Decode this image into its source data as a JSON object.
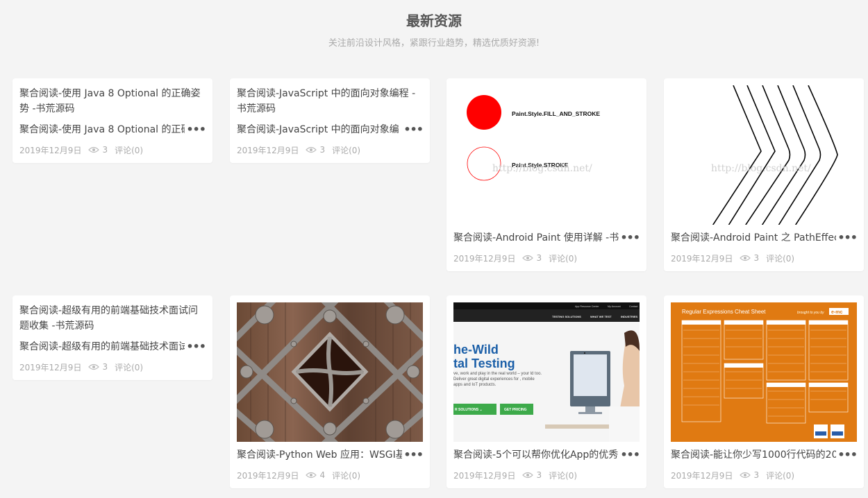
{
  "section": {
    "title": "最新资源",
    "subtitle": "关注前沿设计风格，紧跟行业趋势，精选优质好资源!"
  },
  "cards": [
    {
      "title": "聚合阅读-使用 Java 8 Optional 的正确姿势 -书荒源码",
      "desc": "聚合阅读-使用 Java 8 Optional 的正确",
      "date": "2019年12月9日",
      "views": "3",
      "comments": "评论(0)"
    },
    {
      "title": "聚合阅读-JavaScript 中的面向对象编程 -书荒源码",
      "desc": "聚合阅读-JavaScript 中的面向对象编",
      "date": "2019年12月9日",
      "views": "3",
      "comments": "评论(0)"
    },
    {
      "title": "聚合阅读-Android Paint 使用详解 -书",
      "date": "2019年12月9日",
      "views": "3",
      "comments": "评论(0)",
      "img_label_1": "Paint.Style.FILL_AND_STROKE",
      "img_label_2": "Paint.Style.STROKE",
      "watermark": "http://blog.csdn.net/"
    },
    {
      "title": "聚合阅读-Android Paint 之 PathEffec",
      "date": "2019年12月9日",
      "views": "3",
      "comments": "评论(0)",
      "watermark": "http://blog.csdn.net/"
    },
    {
      "title": "聚合阅读-超级有用的前端基础技术面试问题收集 -书荒源码",
      "desc": "聚合阅读-超级有用的前端基础技术面试",
      "date": "2019年12月9日",
      "views": "3",
      "comments": "评论(0)"
    },
    {
      "title": "聚合阅读-Python Web 应用：WSGI基",
      "date": "2019年12月9日",
      "views": "4",
      "comments": "评论(0)"
    },
    {
      "title": "聚合阅读-5个可以帮你优化App的优秀",
      "date": "2019年12月9日",
      "views": "3",
      "comments": "评论(0)",
      "img_headline_1": "he-Wild",
      "img_headline_2": "tal Testing",
      "img_body": "ve, work and play in the real world – your ld too. Deliver great digital experiences for , mobile apps and IoT products.",
      "img_btn_1": "R SOLUTIONS ⌄",
      "img_btn_2": "GET PRICING",
      "img_nav_1": "App Resource Center",
      "img_nav_2": "My Account",
      "img_nav_3": "Contact",
      "img_nav_4": "TESTING SOLUTIONS",
      "img_nav_5": "WHAT WE TEST",
      "img_nav_6": "INDUSTRIES"
    },
    {
      "title": "聚合阅读-能让你少写1000行代码的20",
      "date": "2019年12月9日",
      "views": "3",
      "comments": "评论(0)",
      "img_title": "Regular Expressions Cheat Sheet",
      "img_byline": "brought to you by",
      "img_brand": "e-mc"
    }
  ],
  "colors": {
    "background": "#f4f4f4",
    "card": "#ffffff",
    "meta_text": "#aaaaaa",
    "title_text": "#444444",
    "cheatsheet_orange": "#e07a12",
    "paint_red": "#ff0000"
  },
  "icons": [
    "eye-icon",
    "more-ellipsis-icon"
  ]
}
